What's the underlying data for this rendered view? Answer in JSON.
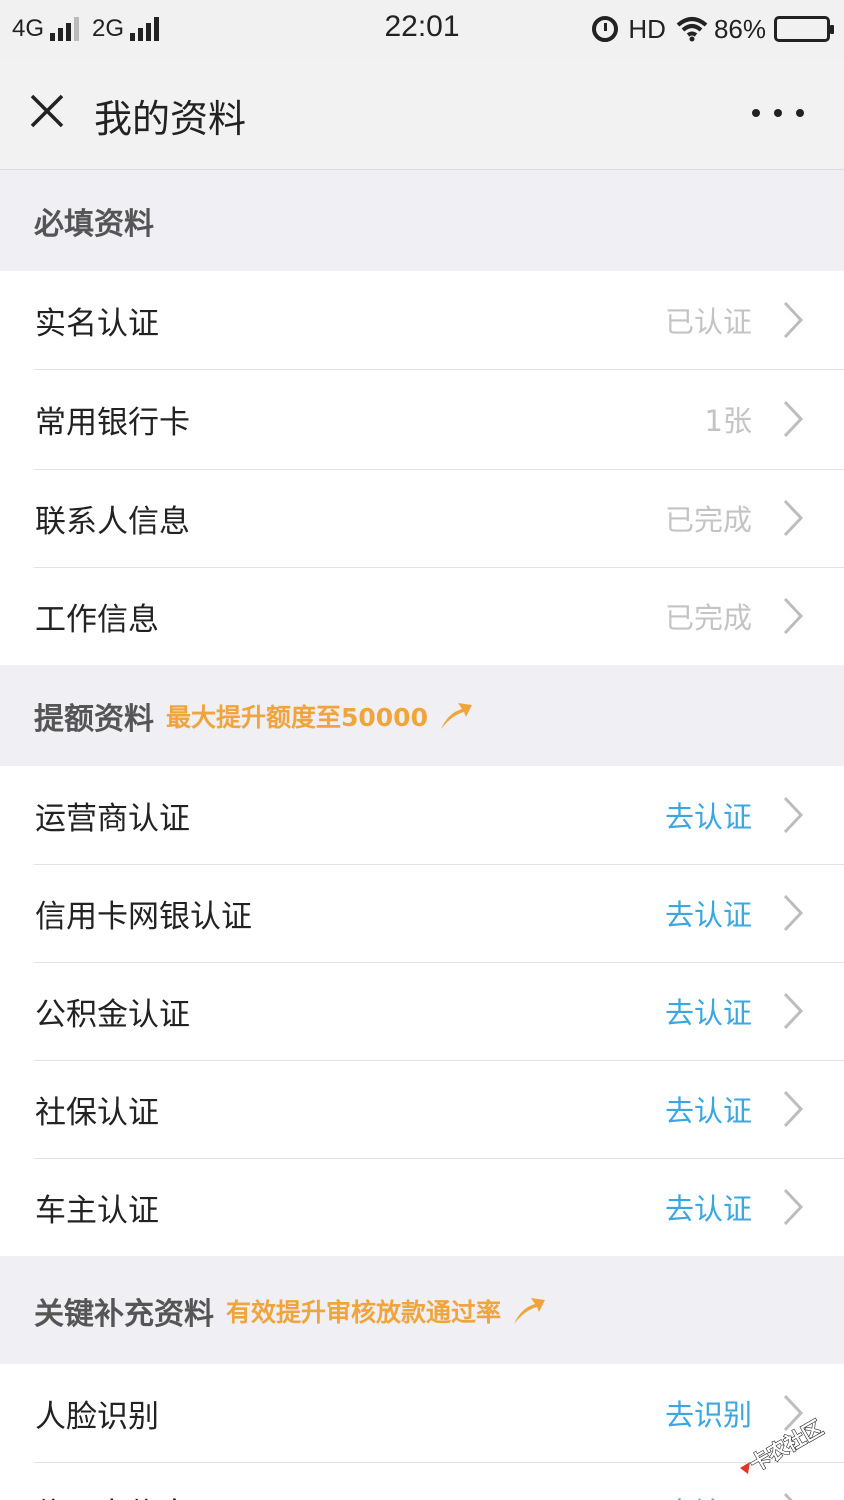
{
  "status_bar": {
    "network1": "4G",
    "network2": "2G",
    "time": "22:01",
    "hd": "HD",
    "battery": "86%",
    "battery_level": 0.86
  },
  "nav": {
    "title": "我的资料"
  },
  "sections": [
    {
      "title": "必填资料",
      "note": "",
      "items": [
        {
          "label": "实名认证",
          "status": "已认证",
          "action": false
        },
        {
          "label": "常用银行卡",
          "status": "1张",
          "action": false
        },
        {
          "label": "联系人信息",
          "status": "已完成",
          "action": false
        },
        {
          "label": "工作信息",
          "status": "已完成",
          "action": false
        }
      ]
    },
    {
      "title": "提额资料",
      "note": "最大提升额度至50000",
      "items": [
        {
          "label": "运营商认证",
          "status": "去认证",
          "action": true
        },
        {
          "label": "信用卡网银认证",
          "status": "去认证",
          "action": true
        },
        {
          "label": "公积金认证",
          "status": "去认证",
          "action": true
        },
        {
          "label": "社保认证",
          "status": "去认证",
          "action": true
        },
        {
          "label": "车主认证",
          "status": "去认证",
          "action": true
        }
      ]
    },
    {
      "title": "关键补充资料",
      "note": "有效提升审核放款通过率",
      "items": [
        {
          "label": "人脸识别",
          "status": "去识别",
          "action": true
        },
        {
          "label": "信用卡信息",
          "status": "去填写",
          "action": true
        }
      ]
    }
  ],
  "colors": {
    "accent_orange": "#f0a53c",
    "action_blue": "#3aa7e0",
    "muted_gray": "#c4c4c4",
    "background": "#efeff4"
  },
  "watermark": {
    "text": "卡农社区"
  }
}
